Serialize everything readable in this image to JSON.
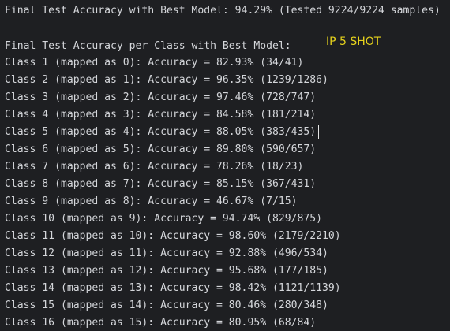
{
  "console": {
    "summary_line": "Final Test Accuracy with Best Model: 94.29% (Tested 9224/9224 samples)",
    "per_class_header": "Final Test Accuracy per Class with Best Model:",
    "annotation": "IP 5 SHOT",
    "class_lines": [
      "Class 1 (mapped as 0): Accuracy = 82.93% (34/41)",
      "Class 2 (mapped as 1): Accuracy = 96.35% (1239/1286)",
      "Class 3 (mapped as 2): Accuracy = 97.46% (728/747)",
      "Class 4 (mapped as 3): Accuracy = 84.58% (181/214)",
      "Class 5 (mapped as 4): Accuracy = 88.05% (383/435)",
      "Class 6 (mapped as 5): Accuracy = 89.80% (590/657)",
      "Class 7 (mapped as 6): Accuracy = 78.26% (18/23)",
      "Class 8 (mapped as 7): Accuracy = 85.15% (367/431)",
      "Class 9 (mapped as 8): Accuracy = 46.67% (7/15)",
      "Class 10 (mapped as 9): Accuracy = 94.74% (829/875)",
      "Class 11 (mapped as 10): Accuracy = 98.60% (2179/2210)",
      "Class 12 (mapped as 11): Accuracy = 92.88% (496/534)",
      "Class 13 (mapped as 12): Accuracy = 95.68% (177/185)",
      "Class 14 (mapped as 13): Accuracy = 98.42% (1121/1139)",
      "Class 15 (mapped as 14): Accuracy = 80.46% (280/348)",
      "Class 16 (mapped as 15): Accuracy = 80.95% (68/84)"
    ]
  },
  "colors": {
    "background": "#1e1f22",
    "text": "#d4d6da",
    "annotation": "#e6d21c"
  }
}
